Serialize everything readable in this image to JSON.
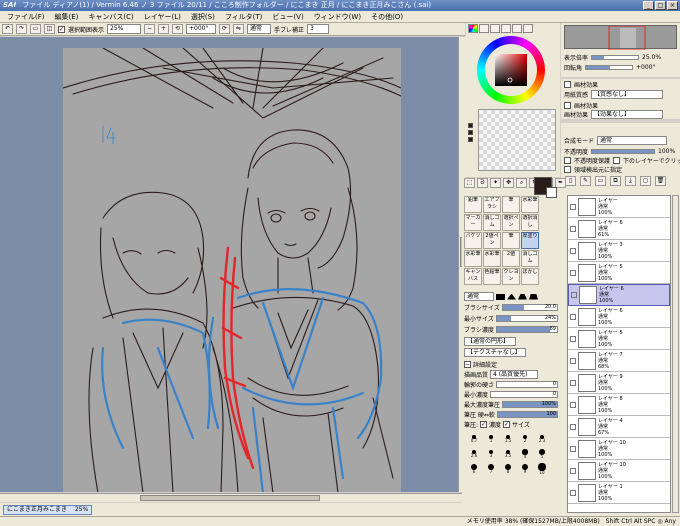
{
  "title_bar": {
    "app_logo": "SAI",
    "text": "ファイル ディアノ(1) / Vermin 6.46 ノ 3 ファイル 20/11 / こころ制作フォルダー / にこまき 正月 / にこまき正月みこさん (.sai)",
    "buttons": [
      "_",
      "□",
      "×"
    ]
  },
  "menu": [
    "ファイル(F)",
    "編集(E)",
    "キャンバス(C)",
    "レイヤー(L)",
    "選択(S)",
    "フィルタ(T)",
    "ビュー(V)",
    "ウィンドウ(W)",
    "その他(O)"
  ],
  "toolbar": {
    "show_selection_label": "選択範囲表示",
    "zoom": "25%",
    "angle": "+000°",
    "blend_mode": "通常",
    "stabilizer_label": "手ブレ補正",
    "stabilizer_value": "3"
  },
  "document_tab": {
    "name": "にこまき正月みこまき",
    "zoom": "25%"
  },
  "navigator": {
    "zoom_label": "表示倍率",
    "zoom_value": "25.0%",
    "angle_label": "回転角",
    "angle_value": "+000°"
  },
  "effects": {
    "header": "画材効果",
    "texture_label": "用紙質感",
    "texture_value": "【質感なし】",
    "effect_header": "画材効果",
    "effect_label": "画材効果",
    "effect_value": "【効果なし】"
  },
  "layer_props": {
    "mode_label": "合成モード",
    "mode_value": "通常",
    "opacity_label": "不透明度",
    "opacity_value": "100%",
    "opacity_fraction": 1.0,
    "protect_label": "不透明度保護",
    "clip_label": "下のレイヤーでクリッピング",
    "source_label": "領域検出元に指定"
  },
  "layers": [
    {
      "name": "レイヤー",
      "mode": "通常",
      "opacity": "100%",
      "selected": false
    },
    {
      "name": "レイヤー 6",
      "mode": "通常",
      "opacity": "61%",
      "selected": false
    },
    {
      "name": "レイヤー 3",
      "mode": "通常",
      "opacity": "100%",
      "selected": false
    },
    {
      "name": "レイヤー 5",
      "mode": "通常",
      "opacity": "100%",
      "selected": false
    },
    {
      "name": "レイヤー 6",
      "mode": "通常",
      "opacity": "100%",
      "selected": true
    },
    {
      "name": "レイヤー 6",
      "mode": "通常",
      "opacity": "100%",
      "selected": false
    },
    {
      "name": "レイヤー 5",
      "mode": "通常",
      "opacity": "100%",
      "selected": false
    },
    {
      "name": "レイヤー 7",
      "mode": "通常",
      "opacity": "68%",
      "selected": false
    },
    {
      "name": "レイヤー 9",
      "mode": "通常",
      "opacity": "100%",
      "selected": false
    },
    {
      "name": "レイヤー 8",
      "mode": "通常",
      "opacity": "100%",
      "selected": false
    },
    {
      "name": "レイヤー 4",
      "mode": "通常",
      "opacity": "67%",
      "selected": false
    },
    {
      "name": "レイヤー 10",
      "mode": "通常",
      "opacity": "100%",
      "selected": false
    },
    {
      "name": "レイヤー 10",
      "mode": "通常",
      "opacity": "100%",
      "selected": false
    },
    {
      "name": "レイヤー 1",
      "mode": "通常",
      "opacity": "100%",
      "selected": false
    }
  ],
  "tools": [
    "鉛筆",
    "エアブラシ",
    "筆",
    "水彩筆",
    "マーカー",
    "消しゴム",
    "選択ペン",
    "選択消し",
    "バケツ",
    "2値ペン",
    "筆",
    "厚塗り",
    "水彩筆",
    "水彩筆",
    "2値",
    "消しゴム",
    "キャンバス",
    "色鉛筆",
    "クレヨン",
    "ぼかし"
  ],
  "selected_tool_index": 11,
  "brush": {
    "blend_mode": "通常",
    "size_label": "ブラシサイズ",
    "size_value": "20.0",
    "size_fraction": 0.4,
    "min_size_label": "最小サイズ",
    "min_size_value": "24%",
    "min_size_fraction": 0.24,
    "density_label": "ブラシ濃度",
    "density_value": "89",
    "density_fraction": 0.89,
    "shape_value": "【通常の円形】",
    "texture_value": "【テクスチャなし】",
    "detail_label": "詳細設定",
    "quality_label": "描画品質",
    "quality_value": "4 (品質優先)",
    "edge_label": "輪郭の硬さ",
    "edge_value": "0",
    "min_density_label": "最小濃度",
    "min_density_value": "0",
    "max_pressure_label": "最大濃度筆圧",
    "max_pressure_value": "100%",
    "hardness_label": "筆圧 硬⇔軟",
    "hardness_value": "100",
    "pressure_label": "筆圧:",
    "pressure_options": [
      "濃度",
      "サイズ"
    ]
  },
  "brush_sizes": [
    "0.7",
    "1",
    "1.5",
    "2",
    "2.3",
    "2.6",
    "3",
    "3.5",
    "4",
    "5",
    "6",
    "7",
    "8",
    "9",
    "10",
    "12",
    "14",
    "16",
    "20",
    "25",
    "30",
    "35",
    "40",
    "50",
    "60",
    "70",
    "80",
    "100",
    "120",
    "150",
    "200",
    "250",
    "300",
    "350",
    "400"
  ],
  "status": {
    "text": "メモリ使用率 38% (確保1527MB/上限4008MB)",
    "keys": "Shift Ctrl Alt SPC ◎ Any"
  },
  "colors": {
    "canvas_bg": "#7d8ca7",
    "paper": "#a6a6a6",
    "line_dark": "#2b1c1c",
    "line_blue": "#3a82c8",
    "line_red": "#e3262a",
    "primary_color": "#2b1c1c"
  }
}
